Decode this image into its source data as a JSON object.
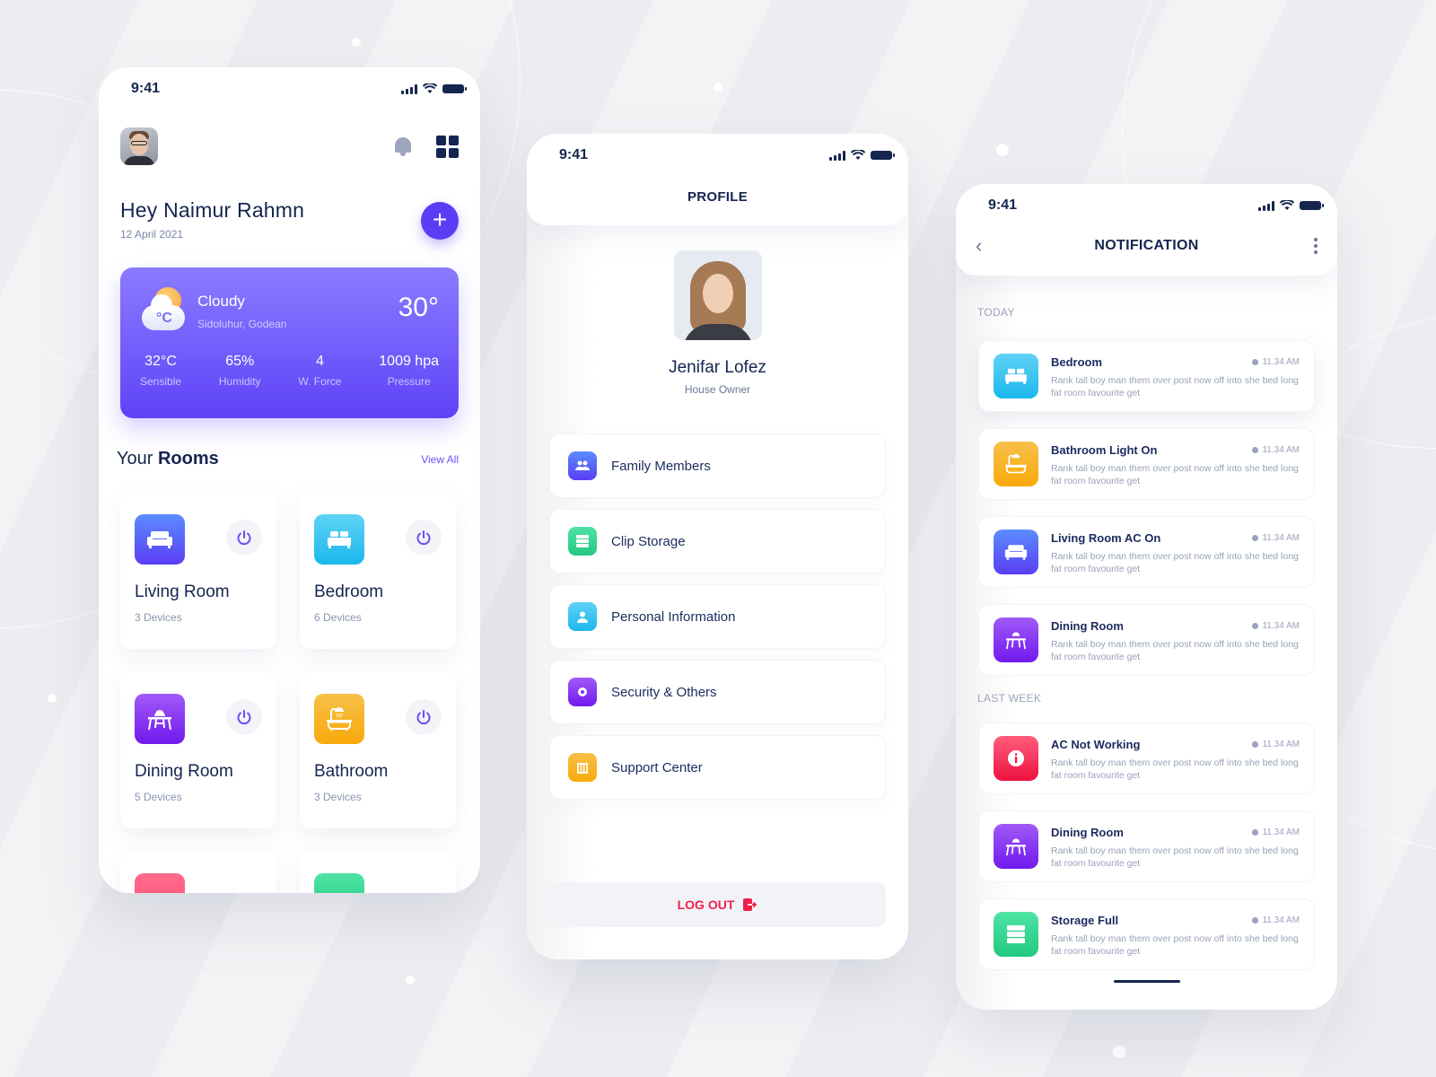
{
  "status_bar": {
    "time": "9:41"
  },
  "home": {
    "greeting": "Hey Naimur Rahmn",
    "date": "12 April 2021",
    "add_button": "+",
    "weather": {
      "condition": "Cloudy",
      "location": "Sidoluhur, Godean",
      "temperature": "30°",
      "icon_label": "°C",
      "stats": [
        {
          "value": "32°C",
          "label": "Sensible"
        },
        {
          "value": "65%",
          "label": "Humidity"
        },
        {
          "value": "4",
          "label": "W. Force"
        },
        {
          "value": "1009 hpa",
          "label": "Pressure"
        }
      ]
    },
    "rooms_title_prefix": "Your",
    "rooms_title_bold": "Rooms",
    "view_all": "View All",
    "rooms": [
      {
        "name": "Living Room",
        "devices": "3 Devices",
        "icon": "sofa-icon",
        "color": "#5a63f7"
      },
      {
        "name": "Bedroom",
        "devices": "6 Devices",
        "icon": "bed-icon",
        "color": "#2cc0f0"
      },
      {
        "name": "Dining Room",
        "devices": "5 Devices",
        "icon": "dining-table-icon",
        "color": "#8a31f3"
      },
      {
        "name": "Bathroom",
        "devices": "3 Devices",
        "icon": "bathtub-icon",
        "color": "#f8b022"
      }
    ]
  },
  "profile": {
    "title": "PROFILE",
    "name": "Jenifar Lofez",
    "role": "House Owner",
    "menu": [
      {
        "label": "Family Members",
        "icon": "users-icon",
        "color": "#5a52f7"
      },
      {
        "label": "Clip Storage",
        "icon": "storage-icon",
        "color": "#2bcf8a"
      },
      {
        "label": "Personal Information",
        "icon": "user-icon",
        "color": "#2cbdf0"
      },
      {
        "label": "Security & Others",
        "icon": "gear-icon",
        "color": "#8a31f3"
      },
      {
        "label": "Support Center",
        "icon": "building-icon",
        "color": "#f8b022"
      }
    ],
    "logout": "LOG OUT"
  },
  "notifications": {
    "title": "NOTIFICATION",
    "sections": [
      {
        "label": "TODAY",
        "items": [
          {
            "title": "Bedroom",
            "time": "11.34 AM",
            "text": "Rank tall boy man them over post now off into she bed long fat room favourite get",
            "icon": "bed-icon"
          },
          {
            "title": "Bathroom Light On",
            "time": "11.34 AM",
            "text": "Rank tall boy man them over post now off into she bed long fat room favourite get",
            "icon": "bathtub-icon"
          },
          {
            "title": "Living Room AC On",
            "time": "11.34 AM",
            "text": "Rank tall boy man them over post now off into she bed long fat room favourite get",
            "icon": "sofa-icon"
          },
          {
            "title": "Dining Room",
            "time": "11.34 AM",
            "text": "Rank tall boy man them over post now off into she bed long fat room favourite get",
            "icon": "dining-table-icon"
          }
        ]
      },
      {
        "label": "LAST WEEK",
        "items": [
          {
            "title": "AC Not Working",
            "time": "11.34 AM",
            "text": "Rank tall boy man them over post now off into she bed long fat room favourite get",
            "icon": "info-icon"
          },
          {
            "title": "Dining Room",
            "time": "11.34 AM",
            "text": "Rank tall boy man them over post now off into she bed long fat room favourite get",
            "icon": "dining-table-icon"
          },
          {
            "title": "Storage Full",
            "time": "11.34 AM",
            "text": "Rank tall boy man them over post now off into she bed long fat room favourite get",
            "icon": "storage-icon"
          }
        ]
      }
    ]
  }
}
